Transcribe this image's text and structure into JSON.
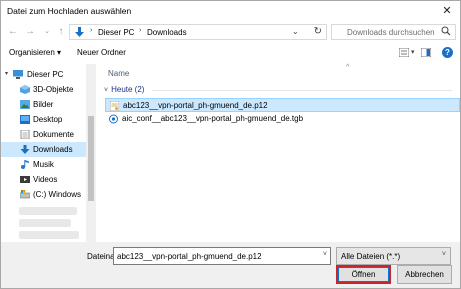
{
  "window": {
    "title": "Datei zum Hochladen auswählen"
  },
  "address": {
    "breadcrumbs": [
      "Dieser PC",
      "Downloads"
    ],
    "search_placeholder": "Downloads durchsuchen"
  },
  "toolbar": {
    "organize_label": "Organisieren ▾",
    "new_folder_label": "Neuer Ordner"
  },
  "sidebar": {
    "items": [
      {
        "label": "Dieser PC",
        "icon": "computer-icon"
      },
      {
        "label": "3D-Objekte",
        "icon": "cube-folder-icon"
      },
      {
        "label": "Bilder",
        "icon": "pictures-folder-icon"
      },
      {
        "label": "Desktop",
        "icon": "desktop-folder-icon"
      },
      {
        "label": "Dokumente",
        "icon": "documents-folder-icon"
      },
      {
        "label": "Downloads",
        "icon": "download-folder-icon",
        "selected": true
      },
      {
        "label": "Musik",
        "icon": "music-folder-icon"
      },
      {
        "label": "Videos",
        "icon": "videos-folder-icon"
      },
      {
        "label": "(C:) Windows",
        "icon": "drive-icon"
      }
    ]
  },
  "main": {
    "column_name": "Name",
    "group_label": "Heute (2)",
    "files": [
      {
        "name": "abc123__vpn-portal_ph-gmuend_de.p12",
        "icon": "certificate-file-icon",
        "selected": true
      },
      {
        "name": "aic_conf__abc123__vpn-portal_ph-gmuend_de.tgb",
        "icon": "config-file-icon",
        "selected": false
      }
    ]
  },
  "bottom": {
    "filename_label": "Dateiname:",
    "filename_value": "abc123__vpn-portal_ph-gmuend_de.p12",
    "filter_value": "Alle Dateien (*.*)",
    "open_label": "Öffnen",
    "cancel_label": "Abbrechen"
  },
  "colors": {
    "selection": "#cce8ff",
    "accent": "#0078d7",
    "open_border": "#c8262c"
  }
}
